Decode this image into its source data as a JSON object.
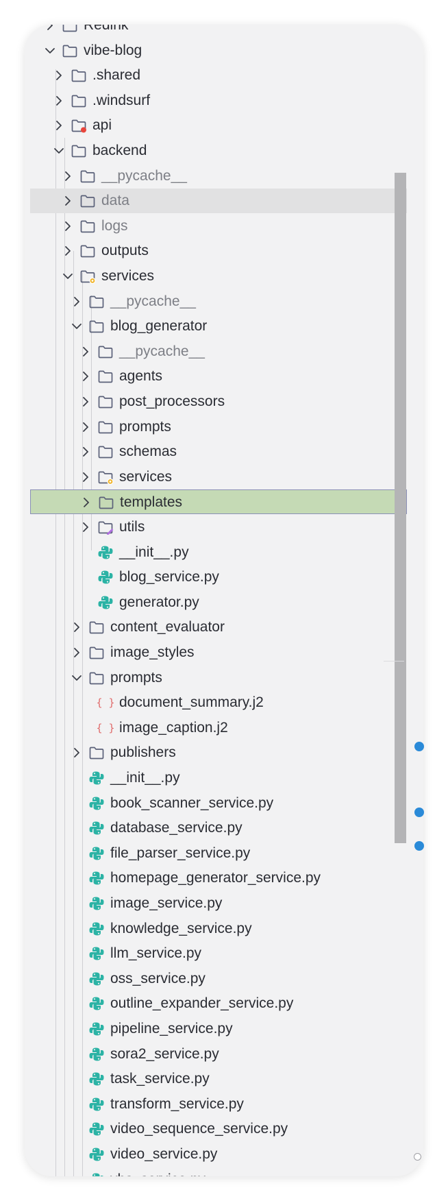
{
  "explorer": {
    "items": [
      {
        "label": "Redink",
        "kind": "folder",
        "depth": 0,
        "expanded": false
      },
      {
        "label": "vibe-blog",
        "kind": "folder",
        "depth": 0,
        "expanded": true
      },
      {
        "label": ".shared",
        "kind": "folder",
        "depth": 1,
        "expanded": false
      },
      {
        "label": ".windsurf",
        "kind": "folder",
        "depth": 1,
        "expanded": false
      },
      {
        "label": "api",
        "kind": "folder-badge-red",
        "depth": 1,
        "expanded": false
      },
      {
        "label": "backend",
        "kind": "folder",
        "depth": 1,
        "expanded": true
      },
      {
        "label": "__pycache__",
        "kind": "folder",
        "depth": 2,
        "expanded": false,
        "dim": true
      },
      {
        "label": "data",
        "kind": "folder",
        "depth": 2,
        "expanded": false,
        "dim": true,
        "state": "hover"
      },
      {
        "label": "logs",
        "kind": "folder",
        "depth": 2,
        "expanded": false,
        "dim": true
      },
      {
        "label": "outputs",
        "kind": "folder",
        "depth": 2,
        "expanded": false
      },
      {
        "label": "services",
        "kind": "folder-badge-gear",
        "depth": 2,
        "expanded": true
      },
      {
        "label": "__pycache__",
        "kind": "folder",
        "depth": 3,
        "expanded": false,
        "dim": true
      },
      {
        "label": "blog_generator",
        "kind": "folder",
        "depth": 3,
        "expanded": true
      },
      {
        "label": "__pycache__",
        "kind": "folder",
        "depth": 4,
        "expanded": false,
        "dim": true
      },
      {
        "label": "agents",
        "kind": "folder",
        "depth": 4,
        "expanded": false
      },
      {
        "label": "post_processors",
        "kind": "folder",
        "depth": 4,
        "expanded": false
      },
      {
        "label": "prompts",
        "kind": "folder",
        "depth": 4,
        "expanded": false
      },
      {
        "label": "schemas",
        "kind": "folder",
        "depth": 4,
        "expanded": false
      },
      {
        "label": "services",
        "kind": "folder-badge-gear",
        "depth": 4,
        "expanded": false
      },
      {
        "label": "templates",
        "kind": "folder",
        "depth": 4,
        "expanded": false,
        "state": "selected"
      },
      {
        "label": "utils",
        "kind": "folder-badge-tool",
        "depth": 4,
        "expanded": false
      },
      {
        "label": "__init__.py",
        "kind": "python",
        "depth": 4
      },
      {
        "label": "blog_service.py",
        "kind": "python",
        "depth": 4
      },
      {
        "label": "generator.py",
        "kind": "python",
        "depth": 4
      },
      {
        "label": "content_evaluator",
        "kind": "folder",
        "depth": 3,
        "expanded": false
      },
      {
        "label": "image_styles",
        "kind": "folder",
        "depth": 3,
        "expanded": false
      },
      {
        "label": "prompts",
        "kind": "folder",
        "depth": 3,
        "expanded": true
      },
      {
        "label": "document_summary.j2",
        "kind": "template",
        "depth": 4
      },
      {
        "label": "image_caption.j2",
        "kind": "template",
        "depth": 4
      },
      {
        "label": "publishers",
        "kind": "folder",
        "depth": 3,
        "expanded": false
      },
      {
        "label": "__init__.py",
        "kind": "python",
        "depth": 3
      },
      {
        "label": "book_scanner_service.py",
        "kind": "python",
        "depth": 3
      },
      {
        "label": "database_service.py",
        "kind": "python",
        "depth": 3
      },
      {
        "label": "file_parser_service.py",
        "kind": "python",
        "depth": 3
      },
      {
        "label": "homepage_generator_service.py",
        "kind": "python",
        "depth": 3
      },
      {
        "label": "image_service.py",
        "kind": "python",
        "depth": 3
      },
      {
        "label": "knowledge_service.py",
        "kind": "python",
        "depth": 3
      },
      {
        "label": "llm_service.py",
        "kind": "python",
        "depth": 3
      },
      {
        "label": "oss_service.py",
        "kind": "python",
        "depth": 3
      },
      {
        "label": "outline_expander_service.py",
        "kind": "python",
        "depth": 3
      },
      {
        "label": "pipeline_service.py",
        "kind": "python",
        "depth": 3
      },
      {
        "label": "sora2_service.py",
        "kind": "python",
        "depth": 3
      },
      {
        "label": "task_service.py",
        "kind": "python",
        "depth": 3
      },
      {
        "label": "transform_service.py",
        "kind": "python",
        "depth": 3
      },
      {
        "label": "video_sequence_service.py",
        "kind": "python",
        "depth": 3
      },
      {
        "label": "video_service.py",
        "kind": "python",
        "depth": 3
      },
      {
        "label": "vhs_service.py",
        "kind": "python",
        "depth": 3
      }
    ]
  },
  "colors": {
    "folder_stroke": "#5b6179",
    "python_icon": "#2bb3a5",
    "template_icon": "#e06a6a",
    "gear_badge": "#f0b429",
    "tool_badge": "#b06fe0",
    "red_badge": "#e8453c",
    "selection": "#c5dab5",
    "status_dot": "#2a8ad8"
  }
}
